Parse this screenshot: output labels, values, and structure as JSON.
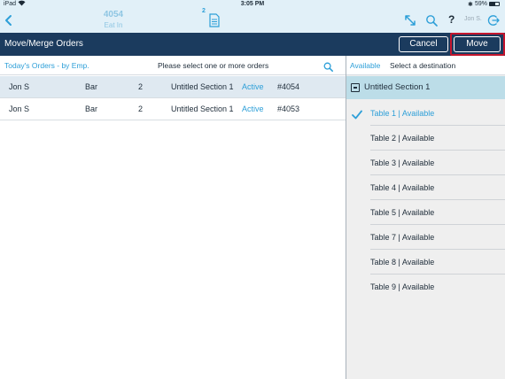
{
  "status_bar": {
    "carrier": "iPad",
    "time": "3:05 PM",
    "bluetooth": "✱",
    "battery_pct": "59%"
  },
  "topbar": {
    "order_number": "4054",
    "order_type": "Eat In",
    "doc_badge": "2",
    "help": "?",
    "user": "Jon S."
  },
  "header": {
    "title": "Move/Merge Orders",
    "cancel_label": "Cancel",
    "move_label": "Move"
  },
  "orders_panel": {
    "filter_label": "Today's Orders - by Emp.",
    "prompt": "Please select one or more orders",
    "rows": [
      {
        "employee": "Jon S",
        "area": "Bar",
        "guests": "2",
        "section": "Untitled Section 1",
        "status": "Active",
        "order": "#4054",
        "selected": true
      },
      {
        "employee": "Jon S",
        "area": "Bar",
        "guests": "2",
        "section": "Untitled Section 1",
        "status": "Active",
        "order": "#4053",
        "selected": false
      }
    ]
  },
  "destination_panel": {
    "filter_label": "Available",
    "prompt": "Select a destination",
    "section": "Untitled Section 1",
    "tables": [
      {
        "label": "Table 1 | Available",
        "selected": true
      },
      {
        "label": "Table 2 | Available",
        "selected": false
      },
      {
        "label": "Table 3 | Available",
        "selected": false
      },
      {
        "label": "Table 4 | Available",
        "selected": false
      },
      {
        "label": "Table 5 | Available",
        "selected": false
      },
      {
        "label": "Table 7 | Available",
        "selected": false
      },
      {
        "label": "Table 8 | Available",
        "selected": false
      },
      {
        "label": "Table 9 | Available",
        "selected": false
      }
    ]
  },
  "colors": {
    "header_bg": "#1b3b5e",
    "accent_blue": "#2d9fd8",
    "topbar_bg": "#e1f0f8",
    "section_bg": "#bcdde8",
    "highlight_border": "#c4152d"
  }
}
